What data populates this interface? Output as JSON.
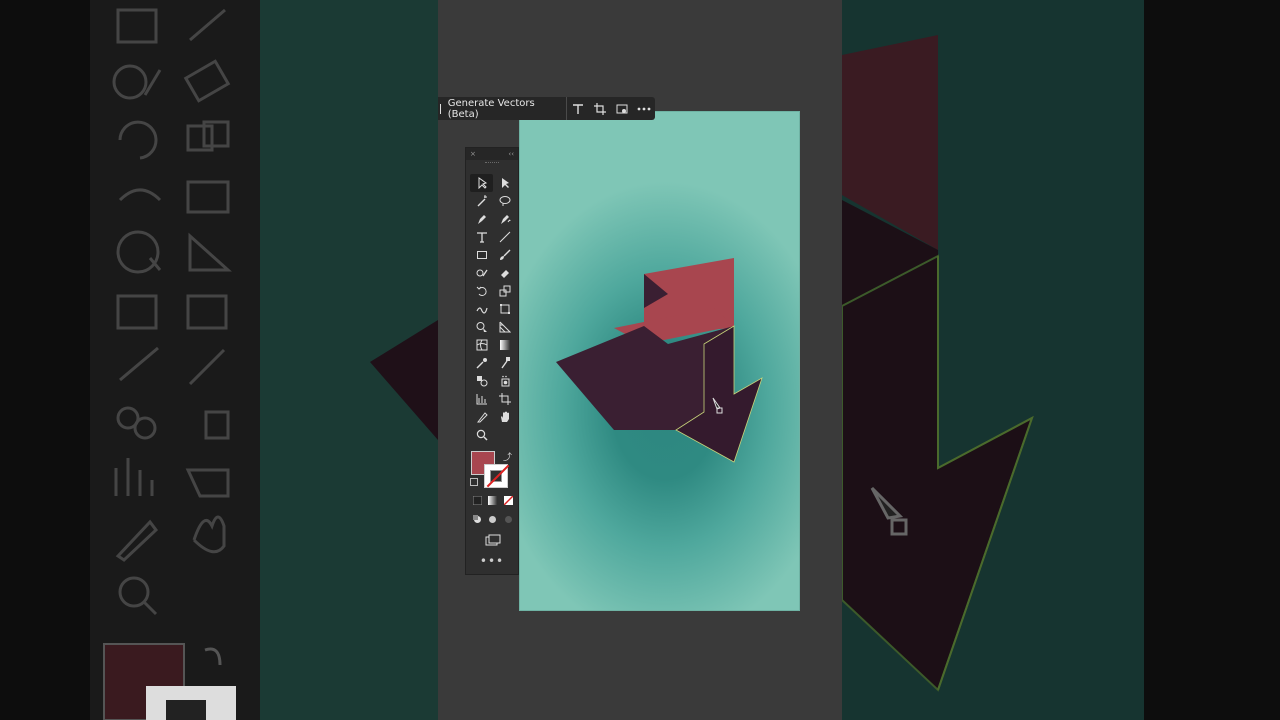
{
  "taskbar": {
    "generate_label": "Generate Vectors (Beta)",
    "icons": [
      "type-icon",
      "crop-icon",
      "image-trace-icon",
      "more-options-icon"
    ]
  },
  "tools_panel": {
    "close_glyph": "×",
    "collapse_glyph": "‹‹",
    "tools": [
      "selection-tool-icon",
      "direct-selection-tool-icon",
      "magic-wand-tool-icon",
      "lasso-tool-icon",
      "pen-tool-icon",
      "curvature-tool-icon",
      "type-tool-icon",
      "line-segment-tool-icon",
      "rectangle-tool-icon",
      "paintbrush-tool-icon",
      "shaper-tool-icon",
      "eraser-tool-icon",
      "rotate-tool-icon",
      "scale-tool-icon",
      "warp-tool-icon",
      "free-transform-tool-icon",
      "shape-builder-tool-icon",
      "perspective-grid-tool-icon",
      "mesh-tool-icon",
      "gradient-tool-icon",
      "eyedropper-tool-icon",
      "eyedropper-alt-tool-icon",
      "blend-tool-icon",
      "symbol-sprayer-tool-icon",
      "graph-tool-icon",
      "artboard-tool-icon",
      "slice-tool-icon",
      "hand-tool-icon",
      "zoom-tool-icon"
    ],
    "swap_glyph": "⤴",
    "more_glyph": "•••"
  },
  "colors": {
    "fill": "#a8464f",
    "stroke": "none",
    "dark_shape": "#3a1f32",
    "red_shape": "#a8464f",
    "panel_bg": "#2f2f2f",
    "app_bg": "#3a3a3a"
  }
}
